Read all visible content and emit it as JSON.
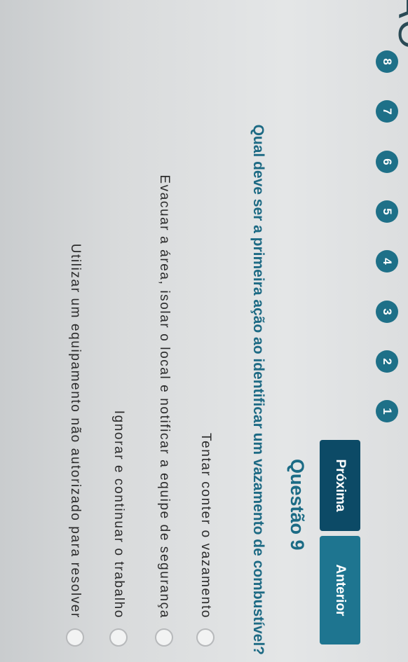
{
  "header": {
    "title_fragment": "ÃO"
  },
  "progress": {
    "steps": [
      "1",
      "2",
      "3",
      "4",
      "5",
      "6",
      "7",
      "8"
    ],
    "accent_color": "#1e7088"
  },
  "nav": {
    "prev_label": "Anterior",
    "next_label": "Próxima"
  },
  "question": {
    "number_label": "Questão 9",
    "text": "Qual deve ser a primeira ação ao identificar um vazamento de combustível?",
    "options": [
      {
        "label": "Tentar conter o vazamento"
      },
      {
        "label": "Evacuar a área, isolar o local e notificar a equipe de segurança"
      },
      {
        "label": "Ignorar e continuar o trabalho"
      },
      {
        "label": "Utilizar um equipamento não autorizado para resolver"
      }
    ]
  }
}
